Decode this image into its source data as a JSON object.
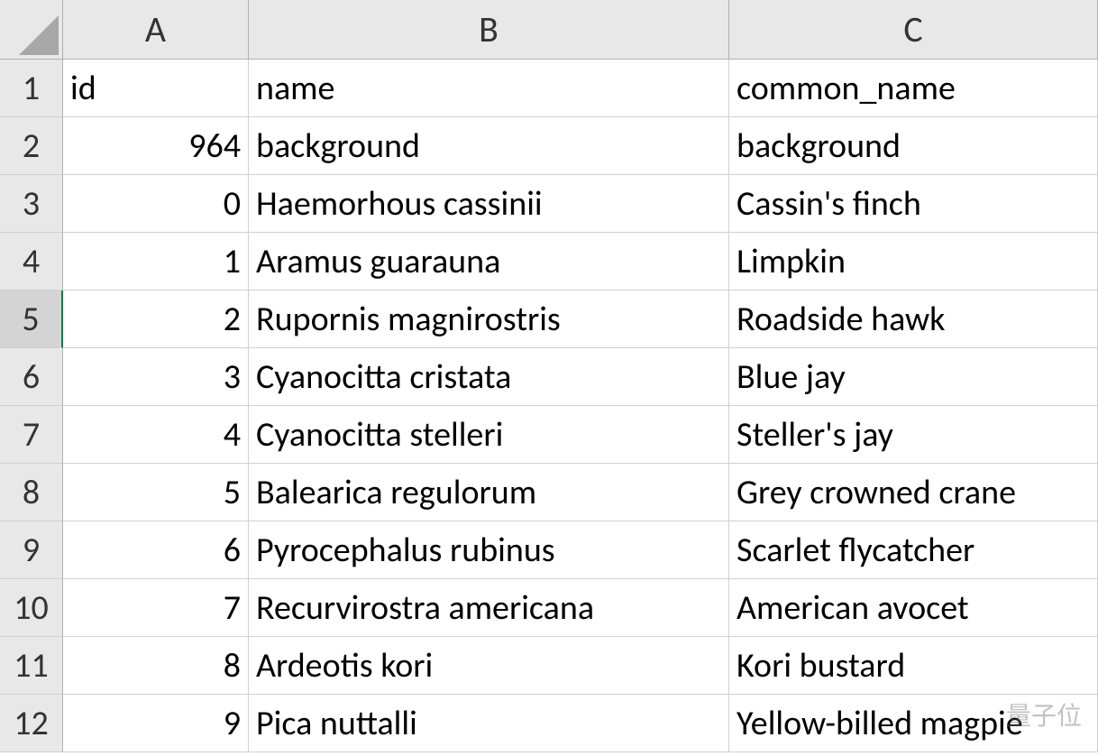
{
  "columns": [
    "A",
    "B",
    "C"
  ],
  "rowNumbers": [
    "1",
    "2",
    "3",
    "4",
    "5",
    "6",
    "7",
    "8",
    "9",
    "10",
    "11",
    "12"
  ],
  "selectedRow": 5,
  "header": {
    "A": "id",
    "B": "name",
    "C": "common_name"
  },
  "rows": [
    {
      "A": "964",
      "B": "background",
      "C": "background"
    },
    {
      "A": "0",
      "B": "Haemorhous cassinii",
      "C": "Cassin's finch"
    },
    {
      "A": "1",
      "B": "Aramus guarauna",
      "C": "Limpkin"
    },
    {
      "A": "2",
      "B": "Rupornis magnirostris",
      "C": "Roadside hawk"
    },
    {
      "A": "3",
      "B": "Cyanocitta cristata",
      "C": "Blue jay"
    },
    {
      "A": "4",
      "B": "Cyanocitta stelleri",
      "C": "Steller's jay"
    },
    {
      "A": "5",
      "B": "Balearica regulorum",
      "C": "Grey crowned crane"
    },
    {
      "A": "6",
      "B": "Pyrocephalus rubinus",
      "C": "Scarlet flycatcher"
    },
    {
      "A": "7",
      "B": "Recurvirostra americana",
      "C": "American avocet"
    },
    {
      "A": "8",
      "B": "Ardeotis kori",
      "C": "Kori bustard"
    },
    {
      "A": "9",
      "B": "Pica nuttalli",
      "C": "Yellow-billed magpie"
    }
  ],
  "watermark": "量子位"
}
